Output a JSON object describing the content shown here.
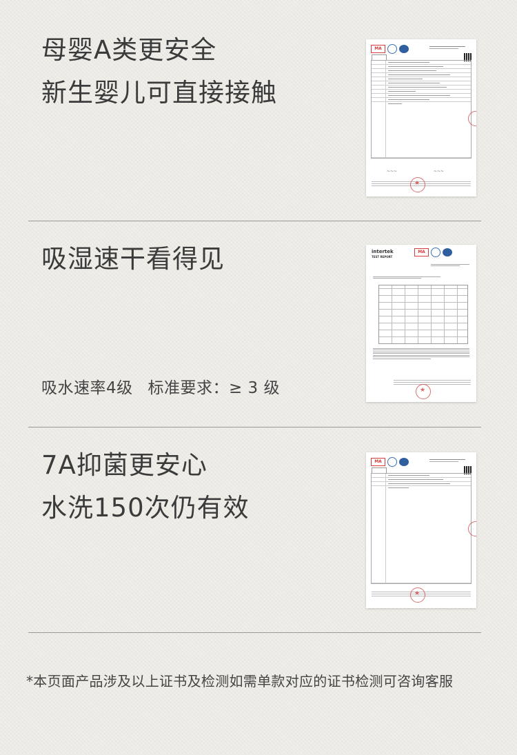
{
  "sections": [
    {
      "lines": [
        "母婴A类更安全",
        "新生婴儿可直接接触"
      ]
    },
    {
      "lines": [
        "吸湿速干看得见"
      ],
      "sub": [
        "吸水速率4级",
        "标准要求：≥ 3 级"
      ]
    },
    {
      "lines": [
        "7A抑菌更安心",
        "水洗150次仍有效"
      ]
    }
  ],
  "footnote": "*本页面产品涉及以上证书及检测如需单款对应的证书检测可咨询客服",
  "certs": [
    {
      "logo": "MA",
      "icons": [
        "cma-logo-icon",
        "ilac-mra-icon",
        "cnas-icon",
        "qr-code-icon",
        "red-seal-icon"
      ]
    },
    {
      "brand": "intertek",
      "report": "TEST REPORT",
      "logo": "MA",
      "icons": [
        "cma-logo-icon",
        "ilac-mra-icon",
        "cnas-icon",
        "red-seal-icon"
      ]
    },
    {
      "logo": "MA",
      "icons": [
        "cma-logo-icon",
        "ilac-mra-icon",
        "cnas-icon",
        "qr-code-icon",
        "red-seal-icon"
      ]
    }
  ],
  "colors": {
    "background": "#f1efe9",
    "text": "#3b3b3b",
    "divider": "#9a9892",
    "seal": "#d63c3c"
  }
}
